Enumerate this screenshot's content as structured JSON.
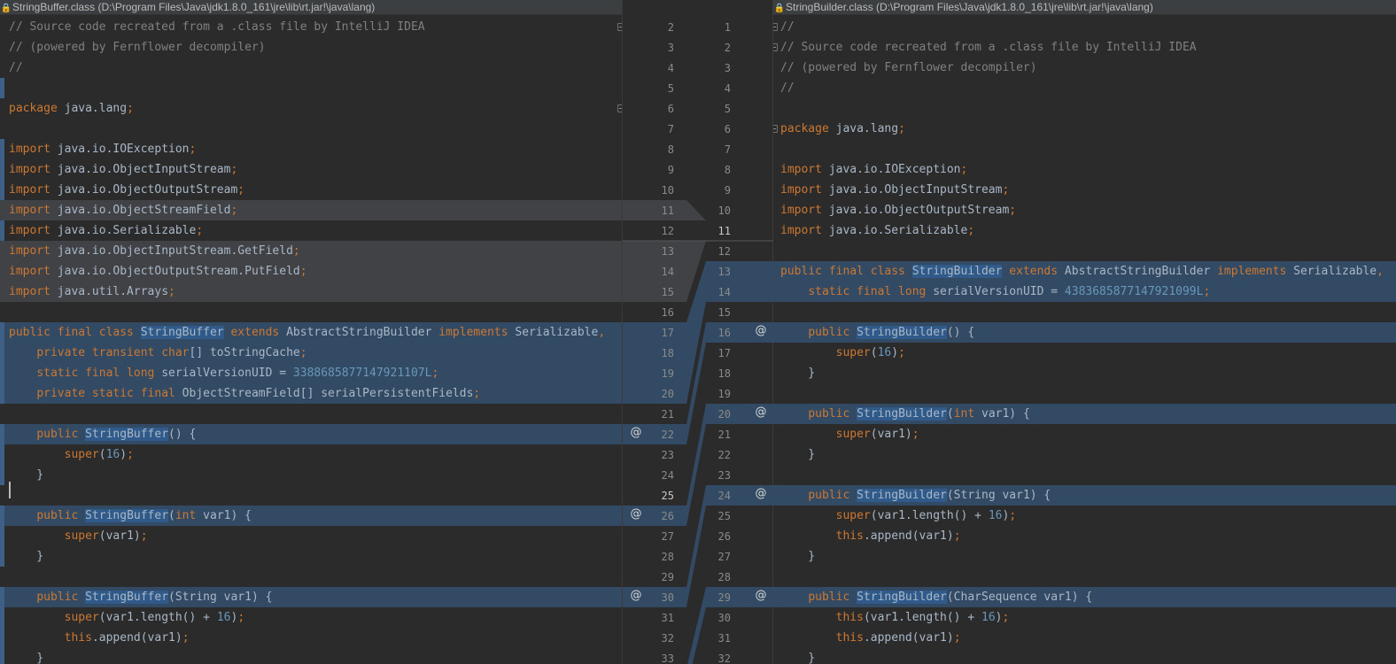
{
  "left_header": {
    "icon": "lock-icon",
    "title": "StringBuffer.class (D:\\Program Files\\Java\\jdk1.8.0_161\\jre\\lib\\rt.jar!\\java\\lang)"
  },
  "right_header": {
    "icon": "lock-icon",
    "title": "StringBuilder.class (D:\\Program Files\\Java\\jdk1.8.0_161\\jre\\lib\\rt.jar!\\java\\lang)"
  },
  "colors": {
    "background": "#2b2b2b",
    "keyword": "#cc7832",
    "number": "#6897bb",
    "comment": "#808080",
    "identifier": "#a9b7c6",
    "changed_block": "#324a63",
    "deleted_block": "#414245",
    "usage_highlight": "#2f5a8a"
  },
  "left_lines": [
    {
      "row": 1,
      "tokens": [
        {
          "t": "// Source code recreated from a .class file by IntelliJ IDEA",
          "c": "cm"
        }
      ]
    },
    {
      "row": 2,
      "tokens": [
        {
          "t": "// (powered by Fernflower decompiler)",
          "c": "cm"
        }
      ]
    },
    {
      "row": 3,
      "tokens": [
        {
          "t": "//",
          "c": "cm"
        }
      ]
    },
    {
      "row": 5,
      "tokens": [
        {
          "t": "package",
          "c": "kw"
        },
        {
          "t": " java.lang"
        },
        {
          "t": ";",
          "c": "kw"
        }
      ]
    },
    {
      "row": 7,
      "tokens": [
        {
          "t": "import",
          "c": "kw"
        },
        {
          "t": " java.io.IOException"
        },
        {
          "t": ";",
          "c": "kw"
        }
      ]
    },
    {
      "row": 8,
      "tokens": [
        {
          "t": "import",
          "c": "kw"
        },
        {
          "t": " java.io.ObjectInputStream"
        },
        {
          "t": ";",
          "c": "kw"
        }
      ]
    },
    {
      "row": 9,
      "tokens": [
        {
          "t": "import",
          "c": "kw"
        },
        {
          "t": " java.io.ObjectOutputStream"
        },
        {
          "t": ";",
          "c": "kw"
        }
      ]
    },
    {
      "row": 10,
      "bg": "del",
      "tokens": [
        {
          "t": "import",
          "c": "kw"
        },
        {
          "t": " java.io.ObjectStreamField"
        },
        {
          "t": ";",
          "c": "kw"
        }
      ]
    },
    {
      "row": 11,
      "tokens": [
        {
          "t": "import",
          "c": "kw"
        },
        {
          "t": " java.io.Serializable"
        },
        {
          "t": ";",
          "c": "kw"
        }
      ]
    },
    {
      "row": 12,
      "bg": "del",
      "tokens": [
        {
          "t": "import",
          "c": "kw"
        },
        {
          "t": " java.io.ObjectInputStream.GetField"
        },
        {
          "t": ";",
          "c": "kw"
        }
      ]
    },
    {
      "row": 13,
      "bg": "del",
      "tokens": [
        {
          "t": "import",
          "c": "kw"
        },
        {
          "t": " java.io.ObjectOutputStream.PutField"
        },
        {
          "t": ";",
          "c": "kw"
        }
      ]
    },
    {
      "row": 14,
      "bg": "del",
      "tokens": [
        {
          "t": "import",
          "c": "kw"
        },
        {
          "t": " java.util.Arrays"
        },
        {
          "t": ";",
          "c": "kw"
        }
      ]
    },
    {
      "row": 16,
      "bg": "ch",
      "tokens": [
        {
          "t": "public final class ",
          "c": "kw"
        },
        {
          "t": "StringBuffer",
          "c": "hl"
        },
        {
          "t": " "
        },
        {
          "t": "extends",
          "c": "kw"
        },
        {
          "t": " AbstractStringBuilder "
        },
        {
          "t": "implements",
          "c": "kw"
        },
        {
          "t": " Serializable"
        },
        {
          "t": ",",
          "c": "kw"
        }
      ]
    },
    {
      "row": 17,
      "bg": "ch",
      "tokens": [
        {
          "t": "    "
        },
        {
          "t": "private transient char",
          "c": "kw"
        },
        {
          "t": "[] toStringCache"
        },
        {
          "t": ";",
          "c": "kw"
        }
      ]
    },
    {
      "row": 18,
      "bg": "ch",
      "tokens": [
        {
          "t": "    "
        },
        {
          "t": "static final long",
          "c": "kw"
        },
        {
          "t": " serialVersionUID = "
        },
        {
          "t": "3388685877147921107L",
          "c": "num"
        },
        {
          "t": ";",
          "c": "kw"
        }
      ]
    },
    {
      "row": 19,
      "bg": "ch",
      "tokens": [
        {
          "t": "    "
        },
        {
          "t": "private static final",
          "c": "kw"
        },
        {
          "t": " ObjectStreamField[] serialPersistentFields"
        },
        {
          "t": ";",
          "c": "kw"
        }
      ]
    },
    {
      "row": 21,
      "bg": "ch",
      "tokens": [
        {
          "t": "    "
        },
        {
          "t": "public",
          "c": "kw"
        },
        {
          "t": " "
        },
        {
          "t": "StringBuffer",
          "c": "hl"
        },
        {
          "t": "() {"
        }
      ]
    },
    {
      "row": 22,
      "tokens": [
        {
          "t": "        "
        },
        {
          "t": "super",
          "c": "kw"
        },
        {
          "t": "("
        },
        {
          "t": "16",
          "c": "num"
        },
        {
          "t": ")"
        },
        {
          "t": ";",
          "c": "kw"
        }
      ]
    },
    {
      "row": 23,
      "tokens": [
        {
          "t": "    }"
        }
      ]
    },
    {
      "row": 25,
      "bg": "ch",
      "tokens": [
        {
          "t": "    "
        },
        {
          "t": "public",
          "c": "kw"
        },
        {
          "t": " "
        },
        {
          "t": "StringBuffer",
          "c": "hl"
        },
        {
          "t": "("
        },
        {
          "t": "int",
          "c": "kw"
        },
        {
          "t": " var1) {"
        }
      ]
    },
    {
      "row": 26,
      "tokens": [
        {
          "t": "        "
        },
        {
          "t": "super",
          "c": "kw"
        },
        {
          "t": "(var1)"
        },
        {
          "t": ";",
          "c": "kw"
        }
      ]
    },
    {
      "row": 27,
      "tokens": [
        {
          "t": "    }"
        }
      ]
    },
    {
      "row": 29,
      "bg": "ch",
      "tokens": [
        {
          "t": "    "
        },
        {
          "t": "public",
          "c": "kw"
        },
        {
          "t": " "
        },
        {
          "t": "StringBuffer",
          "c": "hl"
        },
        {
          "t": "(String var1) {"
        }
      ]
    },
    {
      "row": 30,
      "tokens": [
        {
          "t": "        "
        },
        {
          "t": "super",
          "c": "kw"
        },
        {
          "t": "(var1.length() + "
        },
        {
          "t": "16",
          "c": "num"
        },
        {
          "t": ")"
        },
        {
          "t": ";",
          "c": "kw"
        }
      ]
    },
    {
      "row": 31,
      "tokens": [
        {
          "t": "        "
        },
        {
          "t": "this",
          "c": "kw"
        },
        {
          "t": ".append(var1)"
        },
        {
          "t": ";",
          "c": "kw"
        }
      ]
    },
    {
      "row": 32,
      "tokens": [
        {
          "t": "    }"
        }
      ]
    }
  ],
  "right_lines": [
    {
      "row": 1,
      "tokens": [
        {
          "t": "//",
          "c": "cm"
        }
      ]
    },
    {
      "row": 2,
      "tokens": [
        {
          "t": "// Source code recreated from a .class file by IntelliJ IDEA",
          "c": "cm"
        }
      ]
    },
    {
      "row": 3,
      "tokens": [
        {
          "t": "// (powered by Fernflower decompiler)",
          "c": "cm"
        }
      ]
    },
    {
      "row": 4,
      "tokens": [
        {
          "t": "//",
          "c": "cm"
        }
      ]
    },
    {
      "row": 6,
      "tokens": [
        {
          "t": "package",
          "c": "kw"
        },
        {
          "t": " java.lang"
        },
        {
          "t": ";",
          "c": "kw"
        }
      ]
    },
    {
      "row": 8,
      "tokens": [
        {
          "t": "import",
          "c": "kw"
        },
        {
          "t": " java.io.IOException"
        },
        {
          "t": ";",
          "c": "kw"
        }
      ]
    },
    {
      "row": 9,
      "tokens": [
        {
          "t": "import",
          "c": "kw"
        },
        {
          "t": " java.io.ObjectInputStream"
        },
        {
          "t": ";",
          "c": "kw"
        }
      ]
    },
    {
      "row": 10,
      "tokens": [
        {
          "t": "import",
          "c": "kw"
        },
        {
          "t": " java.io.ObjectOutputStream"
        },
        {
          "t": ";",
          "c": "kw"
        }
      ]
    },
    {
      "row": 11,
      "tokens": [
        {
          "t": "import",
          "c": "kw"
        },
        {
          "t": " java.io.Serializable"
        },
        {
          "t": ";",
          "c": "kw"
        }
      ]
    },
    {
      "row": 13,
      "bg": "ch",
      "tokens": [
        {
          "t": "public final class ",
          "c": "kw"
        },
        {
          "t": "StringBuilder",
          "c": "hl"
        },
        {
          "t": " "
        },
        {
          "t": "extends",
          "c": "kw"
        },
        {
          "t": " AbstractStringBuilder "
        },
        {
          "t": "implements",
          "c": "kw"
        },
        {
          "t": " Serializable"
        },
        {
          "t": ",",
          "c": "kw"
        }
      ]
    },
    {
      "row": 14,
      "bg": "ch",
      "tokens": [
        {
          "t": "    "
        },
        {
          "t": "static final long",
          "c": "kw"
        },
        {
          "t": " serialVersionUID = "
        },
        {
          "t": "4383685877147921099L",
          "c": "num"
        },
        {
          "t": ";",
          "c": "kw"
        }
      ]
    },
    {
      "row": 16,
      "bg": "ch",
      "tokens": [
        {
          "t": "    "
        },
        {
          "t": "public",
          "c": "kw"
        },
        {
          "t": " "
        },
        {
          "t": "StringBuilder",
          "c": "hl"
        },
        {
          "t": "() {"
        }
      ]
    },
    {
      "row": 17,
      "tokens": [
        {
          "t": "        "
        },
        {
          "t": "super",
          "c": "kw"
        },
        {
          "t": "("
        },
        {
          "t": "16",
          "c": "num"
        },
        {
          "t": ")"
        },
        {
          "t": ";",
          "c": "kw"
        }
      ]
    },
    {
      "row": 18,
      "tokens": [
        {
          "t": "    }"
        }
      ]
    },
    {
      "row": 20,
      "bg": "ch",
      "tokens": [
        {
          "t": "    "
        },
        {
          "t": "public",
          "c": "kw"
        },
        {
          "t": " "
        },
        {
          "t": "StringBuilder",
          "c": "hl"
        },
        {
          "t": "("
        },
        {
          "t": "int",
          "c": "kw"
        },
        {
          "t": " var1) {"
        }
      ]
    },
    {
      "row": 21,
      "tokens": [
        {
          "t": "        "
        },
        {
          "t": "super",
          "c": "kw"
        },
        {
          "t": "(var1)"
        },
        {
          "t": ";",
          "c": "kw"
        }
      ]
    },
    {
      "row": 22,
      "tokens": [
        {
          "t": "    }"
        }
      ]
    },
    {
      "row": 24,
      "bg": "ch",
      "tokens": [
        {
          "t": "    "
        },
        {
          "t": "public",
          "c": "kw"
        },
        {
          "t": " "
        },
        {
          "t": "StringBuilder",
          "c": "hl"
        },
        {
          "t": "(String var1) {"
        }
      ]
    },
    {
      "row": 25,
      "tokens": [
        {
          "t": "        "
        },
        {
          "t": "super",
          "c": "kw"
        },
        {
          "t": "(var1.length() + "
        },
        {
          "t": "16",
          "c": "num"
        },
        {
          "t": ")"
        },
        {
          "t": ";",
          "c": "kw"
        }
      ]
    },
    {
      "row": 26,
      "tokens": [
        {
          "t": "        "
        },
        {
          "t": "this",
          "c": "kw"
        },
        {
          "t": ".append(var1)"
        },
        {
          "t": ";",
          "c": "kw"
        }
      ]
    },
    {
      "row": 27,
      "tokens": [
        {
          "t": "    }"
        }
      ]
    },
    {
      "row": 29,
      "bg": "ch",
      "tokens": [
        {
          "t": "    "
        },
        {
          "t": "public",
          "c": "kw"
        },
        {
          "t": " "
        },
        {
          "t": "StringBuilder",
          "c": "hl"
        },
        {
          "t": "(CharSequence var1) {"
        }
      ]
    },
    {
      "row": 30,
      "tokens": [
        {
          "t": "        "
        },
        {
          "t": "this",
          "c": "kw"
        },
        {
          "t": "(var1.length() + "
        },
        {
          "t": "16",
          "c": "num"
        },
        {
          "t": ")"
        },
        {
          "t": ";",
          "c": "kw"
        }
      ]
    },
    {
      "row": 31,
      "tokens": [
        {
          "t": "        "
        },
        {
          "t": "this",
          "c": "kw"
        },
        {
          "t": ".append(var1)"
        },
        {
          "t": ";",
          "c": "kw"
        }
      ]
    },
    {
      "row": 32,
      "tokens": [
        {
          "t": "    }"
        }
      ]
    }
  ],
  "gutter_left_numbers": [
    "2",
    "3",
    "4",
    "5",
    "6",
    "7",
    "8",
    "9",
    "10",
    "11",
    "12",
    "13",
    "14",
    "15",
    "16",
    "17",
    "18",
    "19",
    "20",
    "21",
    "22",
    "23",
    "24",
    "25",
    "26",
    "27",
    "28",
    "29",
    "30",
    "31",
    "32",
    "33"
  ],
  "gutter_right_numbers": [
    "1",
    "2",
    "3",
    "4",
    "5",
    "6",
    "7",
    "8",
    "9",
    "10",
    "11",
    "12",
    "13",
    "14",
    "15",
    "16",
    "17",
    "18",
    "19",
    "20",
    "21",
    "22",
    "23",
    "24",
    "25",
    "26",
    "27",
    "28",
    "29",
    "30",
    "31",
    "32"
  ],
  "gutter_current": {
    "left": "25",
    "right": "11"
  },
  "override_marker": {
    "symbol": "@",
    "icon": "override-at-icon"
  },
  "fold_marker": {
    "icon": "fold-marker-icon"
  }
}
